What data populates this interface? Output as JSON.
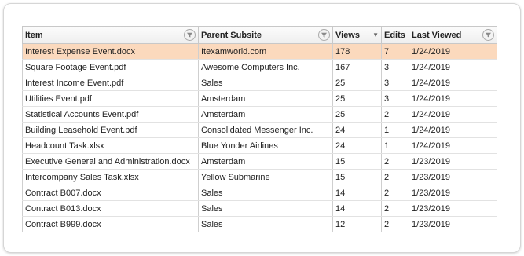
{
  "columns": [
    {
      "label": "Item",
      "has_filter": true
    },
    {
      "label": "Parent Subsite",
      "has_filter": true
    },
    {
      "label": "Views",
      "sort": "descending",
      "sort_icon": "▼"
    },
    {
      "label": "Edits"
    },
    {
      "label": "Last Viewed",
      "has_filter": true
    }
  ],
  "rows": [
    {
      "item": "Interest Expense Event.docx",
      "parent": "Itexamworld.com",
      "views": "178",
      "edits": "7",
      "last_viewed": "1/24/2019",
      "selected": true
    },
    {
      "item": "Square Footage Event.pdf",
      "parent": "Awesome Computers Inc.",
      "views": "167",
      "edits": "3",
      "last_viewed": "1/24/2019"
    },
    {
      "item": "Interest Income Event.pdf",
      "parent": "Sales",
      "views": "25",
      "edits": "3",
      "last_viewed": "1/24/2019"
    },
    {
      "item": "Utilities Event.pdf",
      "parent": "Amsterdam",
      "views": "25",
      "edits": "3",
      "last_viewed": "1/24/2019"
    },
    {
      "item": "Statistical Accounts Event.pdf",
      "parent": "Amsterdam",
      "views": "25",
      "edits": "2",
      "last_viewed": "1/24/2019"
    },
    {
      "item": "Building Leasehold Event.pdf",
      "parent": "Consolidated Messenger Inc.",
      "views": "24",
      "edits": "1",
      "last_viewed": "1/24/2019"
    },
    {
      "item": "Headcount Task.xlsx",
      "parent": "Blue Yonder Airlines",
      "views": "24",
      "edits": "1",
      "last_viewed": "1/24/2019"
    },
    {
      "item": "Executive General and Administration.docx",
      "parent": "Amsterdam",
      "views": "15",
      "edits": "2",
      "last_viewed": "1/23/2019"
    },
    {
      "item": "Intercompany Sales Task.xlsx",
      "parent": "Yellow Submarine",
      "views": "15",
      "edits": "2",
      "last_viewed": "1/23/2019"
    },
    {
      "item": "Contract B007.docx",
      "parent": "Sales",
      "views": "14",
      "edits": "2",
      "last_viewed": "1/23/2019"
    },
    {
      "item": "Contract B013.docx",
      "parent": "Sales",
      "views": "14",
      "edits": "2",
      "last_viewed": "1/23/2019"
    },
    {
      "item": "Contract B999.docx",
      "parent": "Sales",
      "views": "12",
      "edits": "2",
      "last_viewed": "1/23/2019"
    }
  ],
  "colors": {
    "selected_row": "#fbd9bd"
  }
}
